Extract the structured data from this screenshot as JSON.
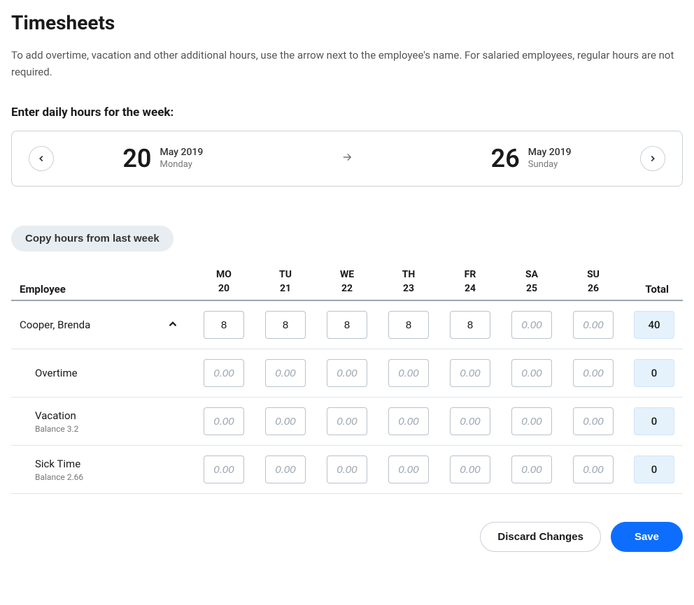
{
  "page": {
    "title": "Timesheets",
    "description": "To add overtime, vacation and other additional hours, use the arrow next to the employee's name. For salaried employees, regular hours are not required.",
    "weekLabel": "Enter daily hours for the week:"
  },
  "dateRange": {
    "start": {
      "day": "20",
      "monthYear": "May 2019",
      "weekday": "Monday"
    },
    "end": {
      "day": "26",
      "monthYear": "May 2019",
      "weekday": "Sunday"
    }
  },
  "actions": {
    "copyLastWeek": "Copy hours from last week",
    "discard": "Discard Changes",
    "save": "Save"
  },
  "table": {
    "employeeHeader": "Employee",
    "totalHeader": "Total",
    "days": [
      {
        "abbr": "MO",
        "num": "20"
      },
      {
        "abbr": "TU",
        "num": "21"
      },
      {
        "abbr": "WE",
        "num": "22"
      },
      {
        "abbr": "TH",
        "num": "23"
      },
      {
        "abbr": "FR",
        "num": "24"
      },
      {
        "abbr": "SA",
        "num": "25"
      },
      {
        "abbr": "SU",
        "num": "26"
      }
    ]
  },
  "employee": {
    "name": "Cooper, Brenda",
    "regular": {
      "values": [
        "8",
        "8",
        "8",
        "8",
        "8",
        "",
        ""
      ],
      "placeholder": "0.00",
      "total": "40"
    },
    "overtime": {
      "label": "Overtime",
      "values": [
        "",
        "",
        "",
        "",
        "",
        "",
        ""
      ],
      "placeholder": "0.00",
      "total": "0"
    },
    "vacation": {
      "label": "Vacation",
      "balance": "Balance 3.2",
      "values": [
        "",
        "",
        "",
        "",
        "",
        "",
        ""
      ],
      "placeholder": "0.00",
      "total": "0"
    },
    "sick": {
      "label": "Sick Time",
      "balance": "Balance 2.66",
      "values": [
        "",
        "",
        "",
        "",
        "",
        "",
        ""
      ],
      "placeholder": "0.00",
      "total": "0"
    }
  }
}
